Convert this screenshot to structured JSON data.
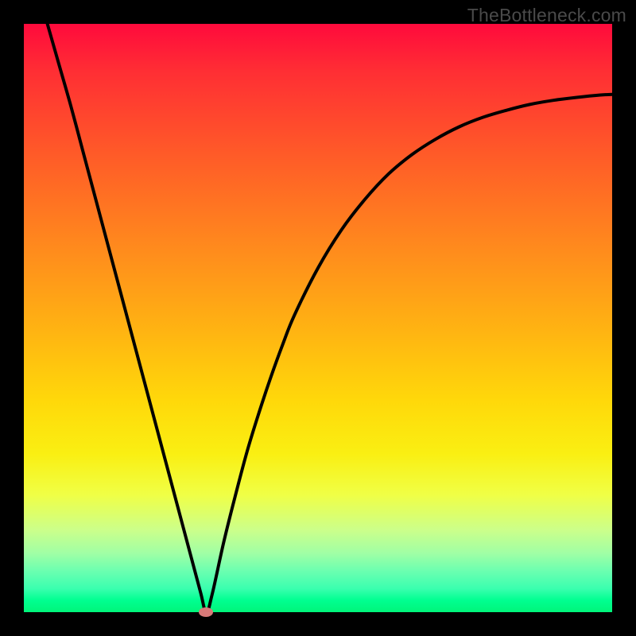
{
  "watermark": "TheBottleneck.com",
  "chart_data": {
    "type": "line",
    "title": "",
    "xlabel": "",
    "ylabel": "",
    "xlim": [
      0,
      100
    ],
    "ylim": [
      0,
      100
    ],
    "grid": false,
    "series": [
      {
        "name": "bottleneck-curve",
        "color": "#000000",
        "x": [
          4,
          6,
          8,
          10,
          12,
          14,
          16,
          18,
          20,
          22,
          24,
          26,
          28,
          30,
          31,
          32,
          34,
          36,
          38,
          40,
          42,
          44,
          46,
          50,
          54,
          58,
          62,
          66,
          70,
          74,
          78,
          82,
          86,
          90,
          94,
          98,
          100
        ],
        "values": [
          100,
          93,
          86,
          78.5,
          71,
          63.5,
          56,
          48.5,
          41,
          33.5,
          26,
          18.5,
          11,
          3.5,
          0,
          3,
          12,
          20,
          27.5,
          34,
          40,
          45.5,
          50.5,
          58.5,
          65,
          70.2,
          74.5,
          77.8,
          80.4,
          82.5,
          84.1,
          85.3,
          86.3,
          87,
          87.5,
          87.9,
          88
        ]
      }
    ],
    "marker": {
      "x": 31,
      "y": 0,
      "color": "#d87a79"
    }
  },
  "colors": {
    "frame": "#000000",
    "gradient_top": "#ff0a3c",
    "gradient_bottom": "#00f57a",
    "curve": "#000000",
    "marker": "#d87a79",
    "watermark": "#4a4a4a"
  }
}
